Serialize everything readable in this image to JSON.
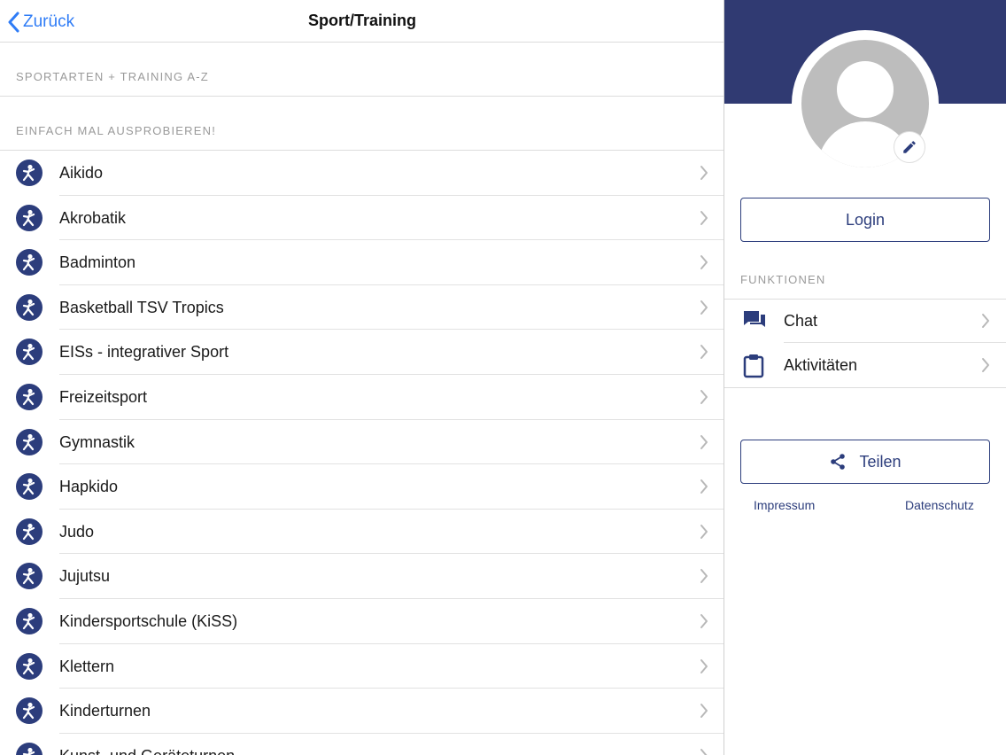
{
  "navbar": {
    "back_label": "Zurück",
    "title": "Sport/Training"
  },
  "sections": {
    "az_label": "SPORTARTEN + TRAINING A-Z",
    "try_label": "EINFACH MAL AUSPROBIEREN!"
  },
  "sports": [
    {
      "label": "Aikido",
      "icon": "martial-arts-kick-icon"
    },
    {
      "label": "Akrobatik",
      "icon": "acrobatics-icon"
    },
    {
      "label": "Badminton",
      "icon": "badminton-icon"
    },
    {
      "label": "Basketball TSV Tropics",
      "icon": "basketball-icon"
    },
    {
      "label": "EISs - integrativer Sport",
      "icon": "integrative-sport-icon"
    },
    {
      "label": "Freizeitsport",
      "icon": "running-icon"
    },
    {
      "label": "Gymnastik",
      "icon": "gymnastics-icon"
    },
    {
      "label": "Hapkido",
      "icon": "martial-arts-kick-icon"
    },
    {
      "label": "Judo",
      "icon": "judo-icon"
    },
    {
      "label": "Jujutsu",
      "icon": "jujutsu-icon"
    },
    {
      "label": "Kindersportschule (KiSS)",
      "icon": "kids-sport-icon"
    },
    {
      "label": "Klettern",
      "icon": "climbing-icon"
    },
    {
      "label": "Kinderturnen",
      "icon": "kids-gymnastics-icon"
    },
    {
      "label": "Kunst- und Geräteturnen",
      "icon": "apparatus-gymnastics-icon"
    }
  ],
  "sidebar": {
    "login_label": "Login",
    "functions_label": "FUNKTIONEN",
    "functions": [
      {
        "label": "Chat",
        "icon": "chat-icon"
      },
      {
        "label": "Aktivitäten",
        "icon": "clipboard-icon"
      }
    ],
    "share_label": "Teilen",
    "impressum_label": "Impressum",
    "datenschutz_label": "Datenschutz"
  },
  "colors": {
    "brand": "#2c3d7c",
    "banner": "#303a72",
    "link_blue": "#2f7cf6",
    "section_text": "#9a9a9a"
  }
}
